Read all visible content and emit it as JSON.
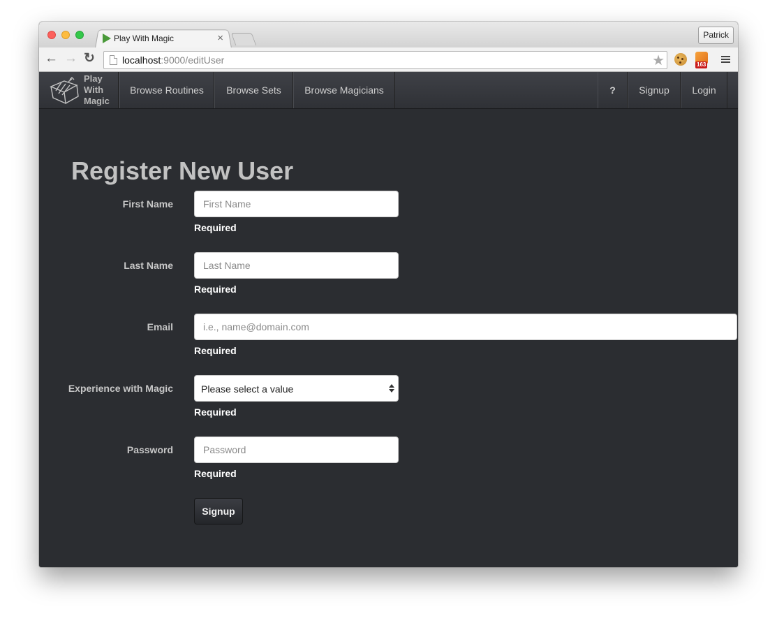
{
  "browser": {
    "tab_title": "Play With Magic",
    "tab_close": "×",
    "profile": "Patrick",
    "url_host": "localhost",
    "url_path": ":9000/editUser",
    "rss_badge": "163"
  },
  "navbar": {
    "brand": "Play With Magic",
    "items": [
      {
        "label": "Browse Routines"
      },
      {
        "label": "Browse Sets"
      },
      {
        "label": "Browse Magicians"
      }
    ],
    "help": "?",
    "signup": "Signup",
    "login": "Login"
  },
  "form": {
    "title": "Register New User",
    "first_name": {
      "label": "First Name",
      "placeholder": "First Name",
      "help": "Required"
    },
    "last_name": {
      "label": "Last Name",
      "placeholder": "Last Name",
      "help": "Required"
    },
    "email": {
      "label": "Email",
      "placeholder": "i.e., name@domain.com",
      "help": "Required"
    },
    "experience": {
      "label": "Experience with Magic",
      "value": "Please select a value",
      "help": "Required"
    },
    "password": {
      "label": "Password",
      "placeholder": "Password",
      "help": "Required"
    },
    "submit": "Signup"
  },
  "colors": {
    "page_background": "#2b2d31",
    "navbar_background": "#3a3c41",
    "title_text": "#c2c2c2",
    "help_text": "#ffffff"
  }
}
